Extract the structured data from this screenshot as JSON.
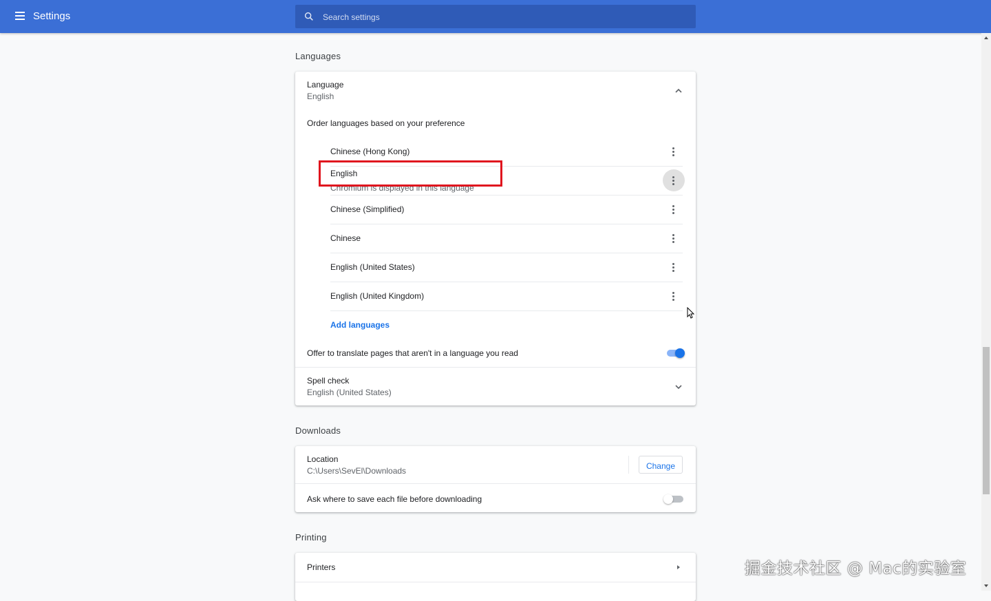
{
  "header": {
    "title": "Settings",
    "search_placeholder": "Search settings"
  },
  "languages": {
    "section_title": "Languages",
    "language_label": "Language",
    "language_value": "English",
    "order_label": "Order languages based on your preference",
    "items": [
      {
        "name": "Chinese (Hong Kong)"
      },
      {
        "name": "English",
        "note": "Chromium is displayed in this language"
      },
      {
        "name": "Chinese (Simplified)"
      },
      {
        "name": "Chinese"
      },
      {
        "name": "English (United States)"
      },
      {
        "name": "English (United Kingdom)"
      }
    ],
    "add_languages": "Add languages",
    "translate_label": "Offer to translate pages that aren't in a language you read",
    "translate_enabled": true,
    "spell_check_label": "Spell check",
    "spell_check_value": "English (United States)"
  },
  "downloads": {
    "section_title": "Downloads",
    "location_label": "Location",
    "location_value": "C:\\Users\\SevEl\\Downloads",
    "change_button": "Change",
    "ask_label": "Ask where to save each file before downloading",
    "ask_enabled": false
  },
  "printing": {
    "section_title": "Printing",
    "printers_label": "Printers"
  },
  "colors": {
    "header": "#3b6fd6",
    "accent": "#1a73e8",
    "highlight": "#e0141e"
  },
  "watermark": "掘金技术社区 @ Mac的实验室"
}
